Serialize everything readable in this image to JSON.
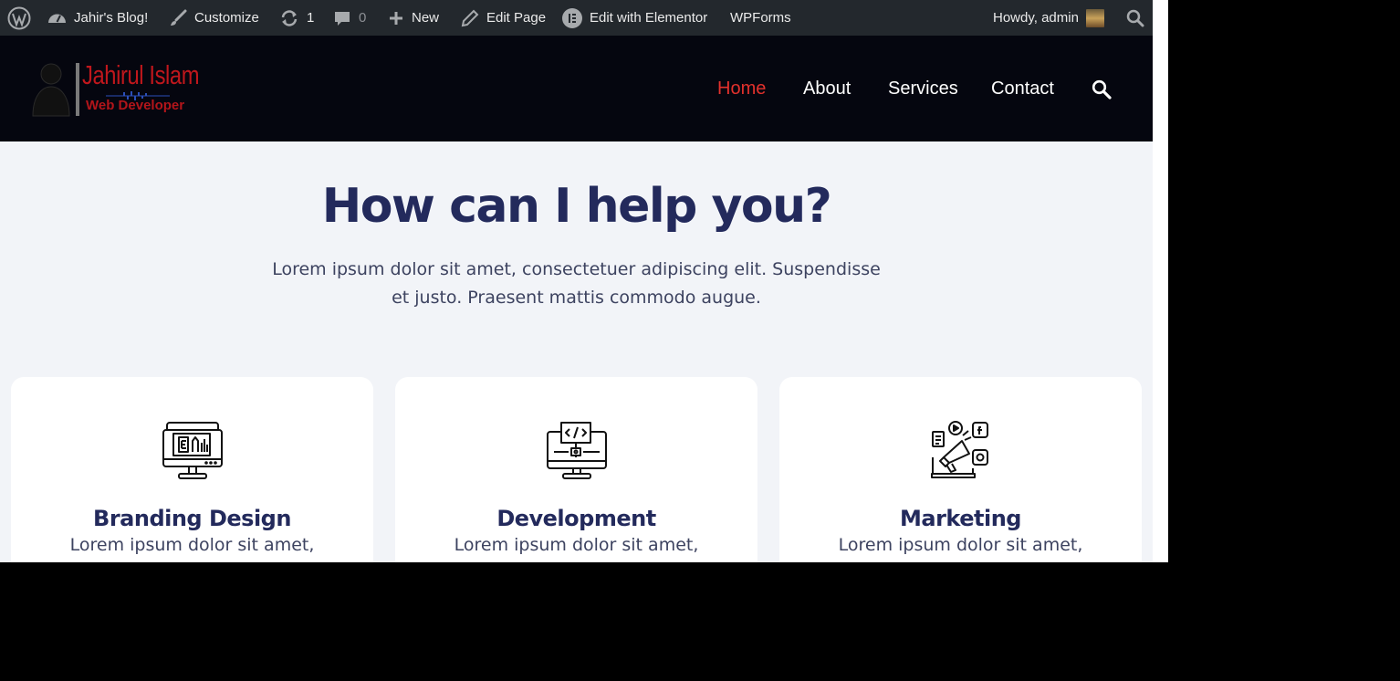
{
  "admin_bar": {
    "wp_logo_icon": "wordpress-icon",
    "site_name": "Jahir's Blog!",
    "customize": "Customize",
    "updates_count": "1",
    "comments_count": "0",
    "new": "New",
    "edit_page": "Edit Page",
    "edit_with_elementor": "Edit with Elementor",
    "wpforms": "WPForms",
    "howdy": "Howdy, admin"
  },
  "header": {
    "logo_name": "Jahirul Islam",
    "logo_tagline": "Web Developer",
    "nav": [
      {
        "label": "Home",
        "active": true
      },
      {
        "label": "About",
        "active": false
      },
      {
        "label": "Services",
        "active": false
      },
      {
        "label": "Contact",
        "active": false
      }
    ]
  },
  "hero": {
    "title": "How can I help you?",
    "text": "Lorem ipsum dolor sit amet, consectetuer adipiscing elit. Suspendisse et justo. Praesent mattis commodo augue."
  },
  "services": [
    {
      "icon": "branding-design-icon",
      "title": "Branding Design",
      "desc": "Lorem ipsum dolor sit amet,"
    },
    {
      "icon": "development-icon",
      "title": "Development",
      "desc": "Lorem ipsum dolor sit amet,"
    },
    {
      "icon": "marketing-icon",
      "title": "Marketing",
      "desc": "Lorem ipsum dolor sit amet,"
    }
  ],
  "colors": {
    "admin_bar_bg": "#23282d",
    "header_bg": "#05060f",
    "accent_red": "#e2312c",
    "heading_navy": "#232a5c",
    "page_bg": "#f2f4f8"
  }
}
